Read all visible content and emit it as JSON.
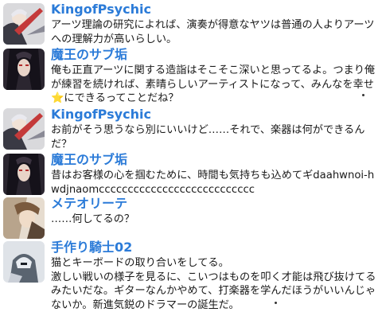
{
  "messages": [
    {
      "author": "KingofPsychic",
      "avatar_icon": "guitarist-avatar-icon",
      "lines": "アーツ理論の研究によれば、演奏が得意なヤツは普通の人よりアーツへの理解力が高いらしい。"
    },
    {
      "author": "魔王のサブ垢",
      "avatar_icon": "dark-haired-character-avatar-icon",
      "line1": "俺も正直アーツに関する造詣はそこそこ深いと思ってるよ。つまり俺が練習を続ければ、素晴らしいアーティストになって、みんなを幸せ",
      "star": "⭐",
      "line2": "にできるってことだね？"
    },
    {
      "author": "KingofPsychic",
      "avatar_icon": "guitarist-avatar-icon",
      "lines": "お前がそう思うなら別にいいけど……それで、楽器は何ができるんだ？"
    },
    {
      "author": "魔王のサブ垢",
      "avatar_icon": "dark-haired-character-avatar-icon",
      "lines": "昔はお客様の心を掴むために、時間も気持ちも込めてギdaahwnoi-hwdjnaomccccccccccccccccccccccccccc"
    },
    {
      "author": "メテオリーテ",
      "avatar_icon": "meteorite-avatar-icon",
      "lines": "……何してるの？"
    },
    {
      "author": "手作り騎士02",
      "avatar_icon": "robot-knight-avatar-icon",
      "lines": "猫とキーボードの取り合いをしてる。\n激しい戦いの様子を見るに、こいつはものを叩く才能は飛び抜けてるみたいだな。ギターなんかやめて、打楽器を学んだほうがいいんじゃないか。新進気鋭のドラマーの誕生だ。"
    }
  ],
  "colors": {
    "name": "#2b7bd8",
    "text": "#1a1a1a",
    "background": "#ffffff"
  }
}
